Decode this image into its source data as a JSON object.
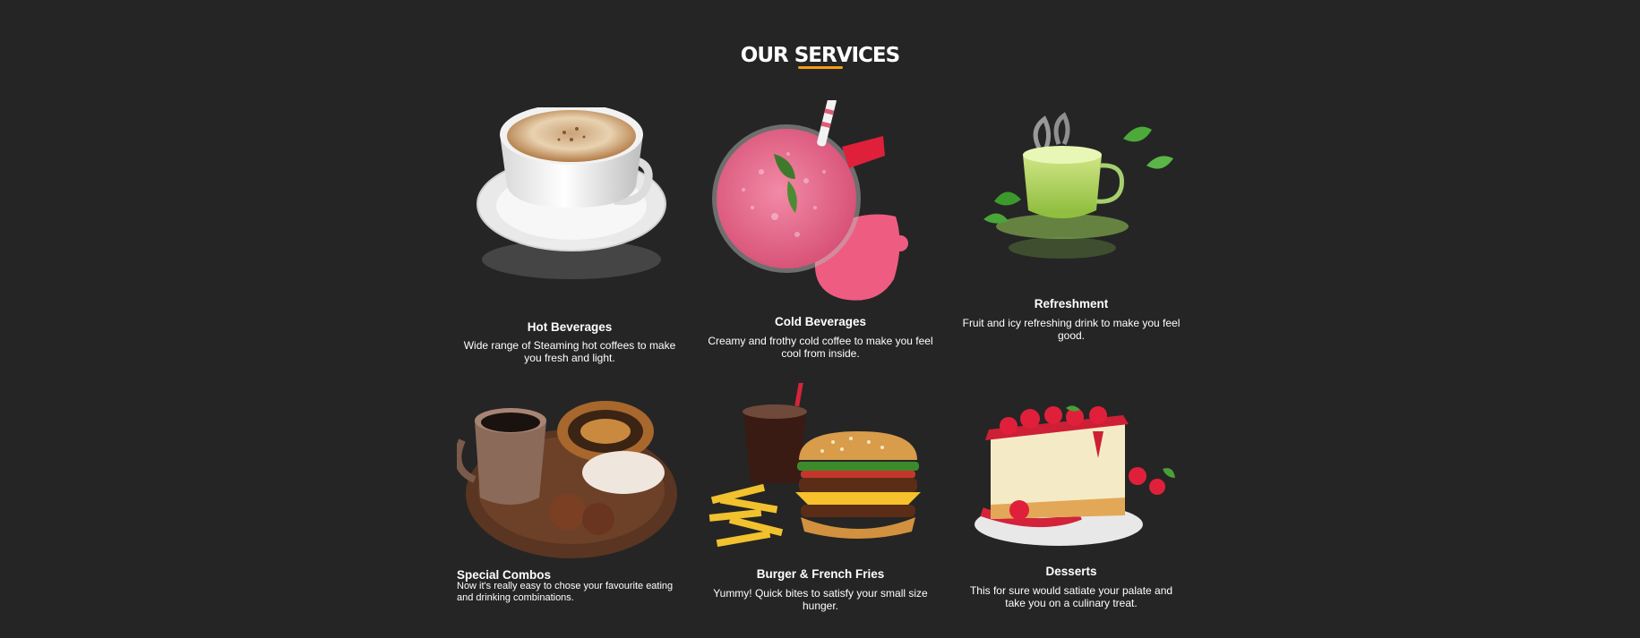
{
  "section": {
    "title": "OUR SERVICES"
  },
  "services": [
    {
      "title": "Hot Beverages",
      "description": "Wide range of Steaming hot coffees to make you fresh and light.",
      "icon": "coffee-cup-icon"
    },
    {
      "title": "Cold Beverages",
      "description": "Creamy and frothy cold coffee to make you feel cool from inside.",
      "icon": "smoothie-glass-icon"
    },
    {
      "title": "Refreshment",
      "description": "Fruit and icy refreshing drink to make you feel good.",
      "icon": "green-tea-icon"
    },
    {
      "title": "Special Combos",
      "description": "Now it's really easy to chose your favourite eating and drinking combinations.",
      "icon": "coffee-pastry-combo-icon"
    },
    {
      "title": "Burger & French Fries",
      "description": "Yummy! Quick bites to satisfy your small size hunger.",
      "icon": "burger-fries-icon"
    },
    {
      "title": "Desserts",
      "description": "This for sure would satiate your palate and take you on a culinary treat.",
      "icon": "cheesecake-icon"
    }
  ],
  "colors": {
    "background": "#252525",
    "accent": "#f39c12",
    "text": "#ffffff"
  }
}
